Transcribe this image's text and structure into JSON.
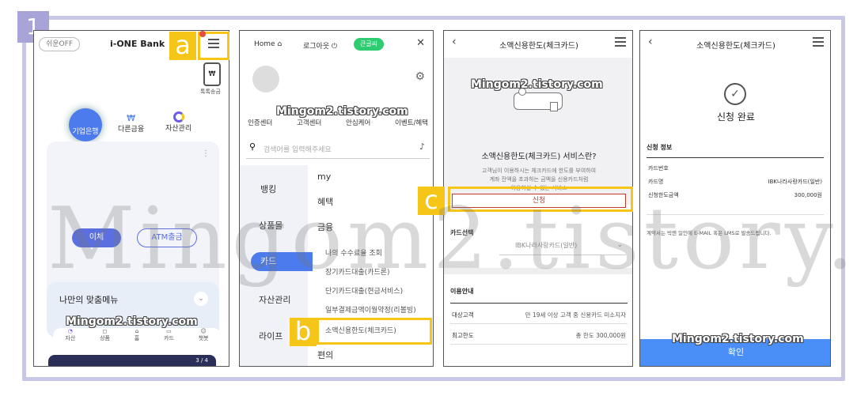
{
  "step_number": "1",
  "markers": {
    "a": "a",
    "b": "b",
    "c": "c"
  },
  "blog_watermark": "Mingom2.tistory.com",
  "big_watermark": "Mingom2.tistory.com",
  "panel1": {
    "toggle": "쉬운OFF",
    "app_title": "i-ONE Bank",
    "quick_transfer": "톡톡송금",
    "tabs": [
      "기업은행",
      "다른금융",
      "자산관리"
    ],
    "transfer_btn": "이체",
    "atm_btn": "ATM출금",
    "custom_menu": "나만의 맞춤메뉴",
    "nav": [
      "자산",
      "상품",
      "홈",
      "카드",
      "챗봇"
    ],
    "bottom_counter": "3 / 4"
  },
  "panel2": {
    "home": "Home",
    "logout": "로그아웃",
    "big_font": "큰글씨",
    "shortcuts": [
      "인증센터",
      "고객센터",
      "안심케어",
      "이벤트/혜택"
    ],
    "search_placeholder": "검색어를 입력해주세요",
    "left_menu": [
      "뱅킹",
      "상품몰",
      "카드",
      "자산관리",
      "라이프"
    ],
    "right_menu": [
      "my",
      "혜택",
      "금융"
    ],
    "sub_menu": [
      "나의 수수료율 조회",
      "장기카드대출(카드론)",
      "단기카드대출(현금서비스)",
      "일부결제금액이월약정(리볼빙)",
      "소액신용한도(체크카드)",
      "편의"
    ]
  },
  "panel3": {
    "title": "소액신용한도(체크카드)",
    "heading": "소액신용한도(체크카드) 서비스란?",
    "desc": [
      "고객님이 이용하시는 체크카드에 한도를 부여하여",
      "계좌 잔액을 초과하는 금액을 신용카드처럼",
      "이용하실 수 있는 서비스"
    ],
    "apply_btn": "신청",
    "card_select_label": "카드선택",
    "card_select_value": "IBK나라사랑카드(일반)",
    "guide_title": "이용안내",
    "rows": [
      {
        "label": "대상고객",
        "value": "만 19세 이상 고객 중 신용카드 미소지자"
      },
      {
        "label": "최고한도",
        "value": "총 한도 300,000원"
      }
    ]
  },
  "panel4": {
    "title": "소액신용한도(체크카드)",
    "done": "신청 완료",
    "info_title": "신청 정보",
    "rows": [
      {
        "label": "카드번호",
        "value": ""
      },
      {
        "label": "카드명",
        "value": "IBK나라사랑카드(일반)"
      },
      {
        "label": "신청한도금액",
        "value": "300,000원"
      }
    ],
    "notice": "계약서는 빅엔 일인에 E-MAIL 혹은 LMS로 발송드립니다.",
    "confirm": "확인"
  },
  "colors": {
    "accent_yellow": "#f5c518",
    "frame": "#c9c7e6",
    "blue": "#4b7bec",
    "green": "#2ecc71",
    "red": "#c0392b",
    "confirm_blue": "#4a8ff7"
  }
}
